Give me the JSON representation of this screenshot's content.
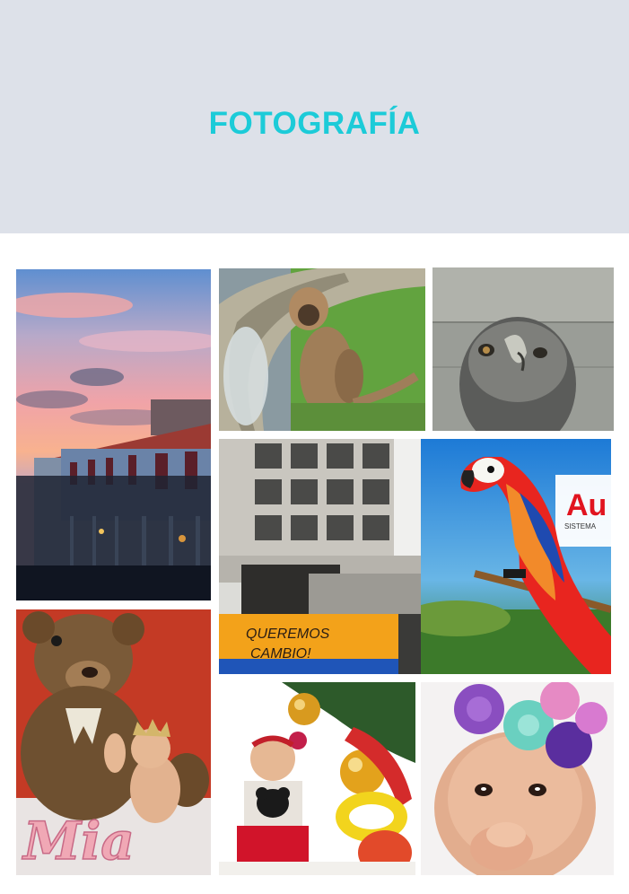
{
  "header": {
    "title": "FOTOGRAFÍA",
    "title_color": "#1ccbd8",
    "background_color": "#dde1e9"
  },
  "gallery": {
    "photos": [
      {
        "subject": "sunset-building-photo"
      },
      {
        "subject": "monkey-photo"
      },
      {
        "subject": "eagle-photo"
      },
      {
        "subject": "concrete-building-graffiti-photo",
        "graffiti_text": "QUEREMOS CAMBIO!"
      },
      {
        "subject": "parrot-mural-photo",
        "mural_text": "Au",
        "mural_subtext": "SISTEMA"
      },
      {
        "subject": "teddy-bear-baby-photo",
        "name_text": "Mia"
      },
      {
        "subject": "christmas-baby-photo"
      },
      {
        "subject": "flower-headband-baby-photo"
      }
    ]
  }
}
